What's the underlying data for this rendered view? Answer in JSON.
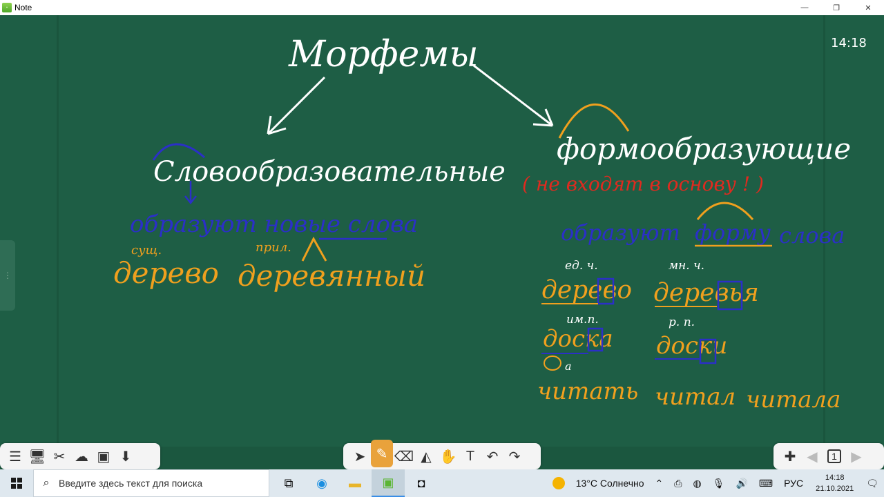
{
  "window": {
    "app_title": "Note",
    "controls": {
      "minimize": "—",
      "restore": "❐",
      "close": "✕"
    }
  },
  "board": {
    "clock": "14:18",
    "colors": {
      "background": "#1e5e45",
      "white_ink": "#ffffff",
      "blue_ink": "#2b2fc8",
      "orange_ink": "#f0a01e",
      "red_ink": "#e02a1f"
    },
    "heading": "Морфемы",
    "left_branch": {
      "title": "Словообразовательные",
      "description": "образуют новые слова",
      "annot_noun": "сущ.",
      "annot_adj": "прил.",
      "example_1": "дерево",
      "example_2": "деревянный"
    },
    "right_branch": {
      "title": "формообразующие",
      "note": "( не входят в основу ! )",
      "description_1": "образуют",
      "description_2": "форму",
      "description_3": "слова",
      "annot_sg": "ед. ч.",
      "annot_pl": "мн. ч.",
      "annot_nom": "им.п.",
      "annot_gen": "р. п.",
      "annot_suffix": "а",
      "word_1": "дерево",
      "word_2": "деревья",
      "word_3": "доска",
      "word_4": "доски",
      "word_5": "читать",
      "word_6": "читал",
      "word_7": "читала"
    }
  },
  "toolbar": {
    "left_icons": [
      "menu-icon",
      "display-icon",
      "tools-icon",
      "cloud-icon",
      "image-icon",
      "export-icon"
    ],
    "center_icons": [
      "cursor-icon",
      "pen-icon",
      "eraser-icon",
      "shape-icon",
      "hand-icon",
      "text-icon",
      "undo-icon",
      "redo-icon"
    ],
    "right_icons": [
      "add-page-icon",
      "prev-page-icon",
      "page-counter-icon",
      "next-page-icon"
    ],
    "page_number": "1"
  },
  "taskbar": {
    "search_placeholder": "Введите здесь текст для поиска",
    "weather": "13°C  Солнечно",
    "language": "РУС",
    "time": "14:18",
    "date": "21.10.2021"
  }
}
